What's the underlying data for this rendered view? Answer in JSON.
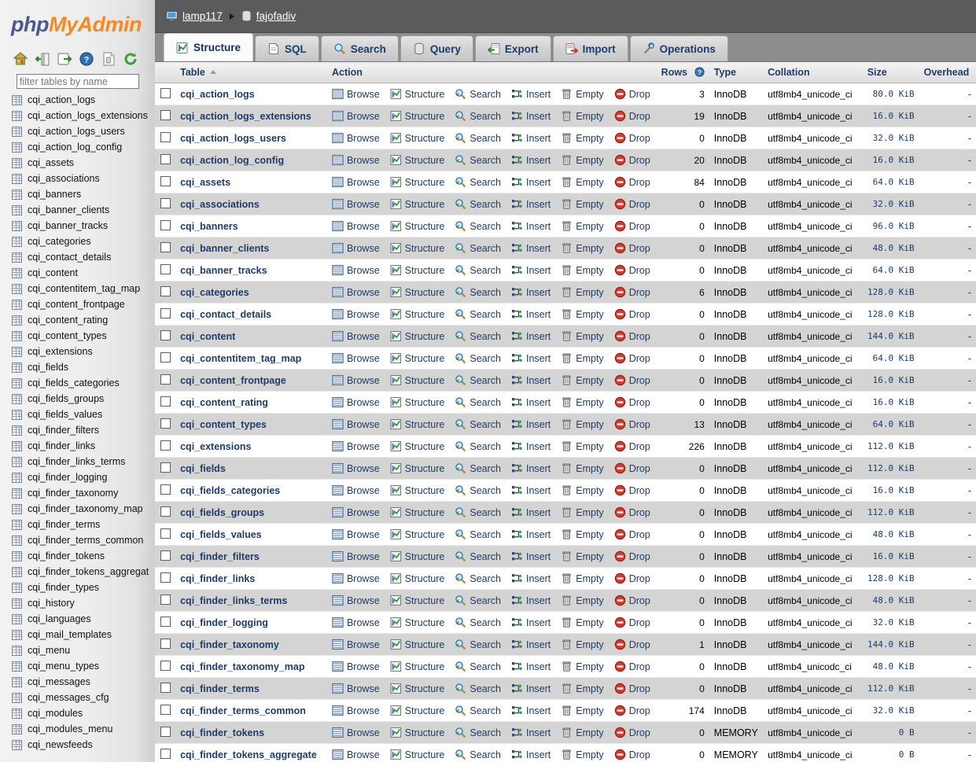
{
  "sidebar": {
    "logo_php": "php",
    "logo_myadmin": "MyAdmin",
    "icons": [
      {
        "name": "home-icon",
        "title": "Home"
      },
      {
        "name": "logout-icon",
        "title": "Log out"
      },
      {
        "name": "export-icon",
        "title": "Export"
      },
      {
        "name": "help-icon",
        "title": "Help"
      },
      {
        "name": "documentation-icon",
        "title": "Documentation"
      },
      {
        "name": "reload-icon",
        "title": "Reload navigation"
      }
    ],
    "filter_placeholder": "filter tables by name",
    "filter_value": "",
    "tables": [
      "cqi_action_logs",
      "cqi_action_logs_extensions",
      "cqi_action_logs_users",
      "cqi_action_log_config",
      "cqi_assets",
      "cqi_associations",
      "cqi_banners",
      "cqi_banner_clients",
      "cqi_banner_tracks",
      "cqi_categories",
      "cqi_contact_details",
      "cqi_content",
      "cqi_contentitem_tag_map",
      "cqi_content_frontpage",
      "cqi_content_rating",
      "cqi_content_types",
      "cqi_extensions",
      "cqi_fields",
      "cqi_fields_categories",
      "cqi_fields_groups",
      "cqi_fields_values",
      "cqi_finder_filters",
      "cqi_finder_links",
      "cqi_finder_links_terms",
      "cqi_finder_logging",
      "cqi_finder_taxonomy",
      "cqi_finder_taxonomy_map",
      "cqi_finder_terms",
      "cqi_finder_terms_common",
      "cqi_finder_tokens",
      "cqi_finder_tokens_aggregat",
      "cqi_finder_types",
      "cqi_history",
      "cqi_languages",
      "cqi_mail_templates",
      "cqi_menu",
      "cqi_menu_types",
      "cqi_messages",
      "cqi_messages_cfg",
      "cqi_modules",
      "cqi_modules_menu",
      "cqi_newsfeeds"
    ]
  },
  "breadcrumb": {
    "server": "lamp117",
    "database": "fajofadiv"
  },
  "tabs": [
    {
      "label": "Structure",
      "icon": "structure-icon",
      "active": true
    },
    {
      "label": "SQL",
      "icon": "sql-icon",
      "active": false
    },
    {
      "label": "Search",
      "icon": "search-icon",
      "active": false
    },
    {
      "label": "Query",
      "icon": "query-icon",
      "active": false
    },
    {
      "label": "Export",
      "icon": "export-icon",
      "active": false
    },
    {
      "label": "Import",
      "icon": "import-icon",
      "active": false
    },
    {
      "label": "Operations",
      "icon": "operations-icon",
      "active": false
    }
  ],
  "table_headers": {
    "table": "Table",
    "action": "Action",
    "rows": "Rows",
    "type": "Type",
    "collation": "Collation",
    "size": "Size",
    "overhead": "Overhead"
  },
  "action_labels": {
    "browse": "Browse",
    "structure": "Structure",
    "search": "Search",
    "insert": "Insert",
    "empty": "Empty",
    "drop": "Drop"
  },
  "rows": [
    {
      "name": "cqi_action_logs",
      "rows": "3",
      "type": "InnoDB",
      "collation": "utf8mb4_unicode_ci",
      "size": "80.0 KiB",
      "overhead": "-"
    },
    {
      "name": "cqi_action_logs_extensions",
      "rows": "19",
      "type": "InnoDB",
      "collation": "utf8mb4_unicode_ci",
      "size": "16.0 KiB",
      "overhead": "-"
    },
    {
      "name": "cqi_action_logs_users",
      "rows": "0",
      "type": "InnoDB",
      "collation": "utf8mb4_unicode_ci",
      "size": "32.0 KiB",
      "overhead": "-"
    },
    {
      "name": "cqi_action_log_config",
      "rows": "20",
      "type": "InnoDB",
      "collation": "utf8mb4_unicode_ci",
      "size": "16.0 KiB",
      "overhead": "-"
    },
    {
      "name": "cqi_assets",
      "rows": "84",
      "type": "InnoDB",
      "collation": "utf8mb4_unicode_ci",
      "size": "64.0 KiB",
      "overhead": "-"
    },
    {
      "name": "cqi_associations",
      "rows": "0",
      "type": "InnoDB",
      "collation": "utf8mb4_unicode_ci",
      "size": "32.0 KiB",
      "overhead": "-"
    },
    {
      "name": "cqi_banners",
      "rows": "0",
      "type": "InnoDB",
      "collation": "utf8mb4_unicode_ci",
      "size": "96.0 KiB",
      "overhead": "-"
    },
    {
      "name": "cqi_banner_clients",
      "rows": "0",
      "type": "InnoDB",
      "collation": "utf8mb4_unicode_ci",
      "size": "48.0 KiB",
      "overhead": "-"
    },
    {
      "name": "cqi_banner_tracks",
      "rows": "0",
      "type": "InnoDB",
      "collation": "utf8mb4_unicode_ci",
      "size": "64.0 KiB",
      "overhead": "-"
    },
    {
      "name": "cqi_categories",
      "rows": "6",
      "type": "InnoDB",
      "collation": "utf8mb4_unicode_ci",
      "size": "128.0 KiB",
      "overhead": "-"
    },
    {
      "name": "cqi_contact_details",
      "rows": "0",
      "type": "InnoDB",
      "collation": "utf8mb4_unicode_ci",
      "size": "128.0 KiB",
      "overhead": "-"
    },
    {
      "name": "cqi_content",
      "rows": "0",
      "type": "InnoDB",
      "collation": "utf8mb4_unicode_ci",
      "size": "144.0 KiB",
      "overhead": "-"
    },
    {
      "name": "cqi_contentitem_tag_map",
      "rows": "0",
      "type": "InnoDB",
      "collation": "utf8mb4_unicode_ci",
      "size": "64.0 KiB",
      "overhead": "-"
    },
    {
      "name": "cqi_content_frontpage",
      "rows": "0",
      "type": "InnoDB",
      "collation": "utf8mb4_unicode_ci",
      "size": "16.0 KiB",
      "overhead": "-"
    },
    {
      "name": "cqi_content_rating",
      "rows": "0",
      "type": "InnoDB",
      "collation": "utf8mb4_unicode_ci",
      "size": "16.0 KiB",
      "overhead": "-"
    },
    {
      "name": "cqi_content_types",
      "rows": "13",
      "type": "InnoDB",
      "collation": "utf8mb4_unicode_ci",
      "size": "64.0 KiB",
      "overhead": "-"
    },
    {
      "name": "cqi_extensions",
      "rows": "226",
      "type": "InnoDB",
      "collation": "utf8mb4_unicode_ci",
      "size": "112.0 KiB",
      "overhead": "-"
    },
    {
      "name": "cqi_fields",
      "rows": "0",
      "type": "InnoDB",
      "collation": "utf8mb4_unicode_ci",
      "size": "112.0 KiB",
      "overhead": "-"
    },
    {
      "name": "cqi_fields_categories",
      "rows": "0",
      "type": "InnoDB",
      "collation": "utf8mb4_unicode_ci",
      "size": "16.0 KiB",
      "overhead": "-"
    },
    {
      "name": "cqi_fields_groups",
      "rows": "0",
      "type": "InnoDB",
      "collation": "utf8mb4_unicode_ci",
      "size": "112.0 KiB",
      "overhead": "-"
    },
    {
      "name": "cqi_fields_values",
      "rows": "0",
      "type": "InnoDB",
      "collation": "utf8mb4_unicode_ci",
      "size": "48.0 KiB",
      "overhead": "-"
    },
    {
      "name": "cqi_finder_filters",
      "rows": "0",
      "type": "InnoDB",
      "collation": "utf8mb4_unicode_ci",
      "size": "16.0 KiB",
      "overhead": "-"
    },
    {
      "name": "cqi_finder_links",
      "rows": "0",
      "type": "InnoDB",
      "collation": "utf8mb4_unicode_ci",
      "size": "128.0 KiB",
      "overhead": "-"
    },
    {
      "name": "cqi_finder_links_terms",
      "rows": "0",
      "type": "InnoDB",
      "collation": "utf8mb4_unicode_ci",
      "size": "48.0 KiB",
      "overhead": "-"
    },
    {
      "name": "cqi_finder_logging",
      "rows": "0",
      "type": "InnoDB",
      "collation": "utf8mb4_unicode_ci",
      "size": "32.0 KiB",
      "overhead": "-"
    },
    {
      "name": "cqi_finder_taxonomy",
      "rows": "1",
      "type": "InnoDB",
      "collation": "utf8mb4_unicode_ci",
      "size": "144.0 KiB",
      "overhead": "-"
    },
    {
      "name": "cqi_finder_taxonomy_map",
      "rows": "0",
      "type": "InnoDB",
      "collation": "utf8mb4_unicodc_ci",
      "size": "48.0 KiB",
      "overhead": "-"
    },
    {
      "name": "cqi_finder_terms",
      "rows": "0",
      "type": "InnoDB",
      "collation": "utf8mb4_unicode_ci",
      "size": "112.0 KiB",
      "overhead": "-"
    },
    {
      "name": "cqi_finder_terms_common",
      "rows": "174",
      "type": "InnoDB",
      "collation": "utf8mb4_unicode_ci",
      "size": "32.0 KiB",
      "overhead": "-"
    },
    {
      "name": "cqi_finder_tokens",
      "rows": "0",
      "type": "MEMORY",
      "collation": "utf8mb4_unicode_ci",
      "size": "0 B",
      "overhead": "-"
    },
    {
      "name": "cqi_finder_tokens_aggregate",
      "rows": "0",
      "type": "MEMORY",
      "collation": "utf8mb4_unicode_ci",
      "size": "0 B",
      "overhead": "-"
    }
  ]
}
